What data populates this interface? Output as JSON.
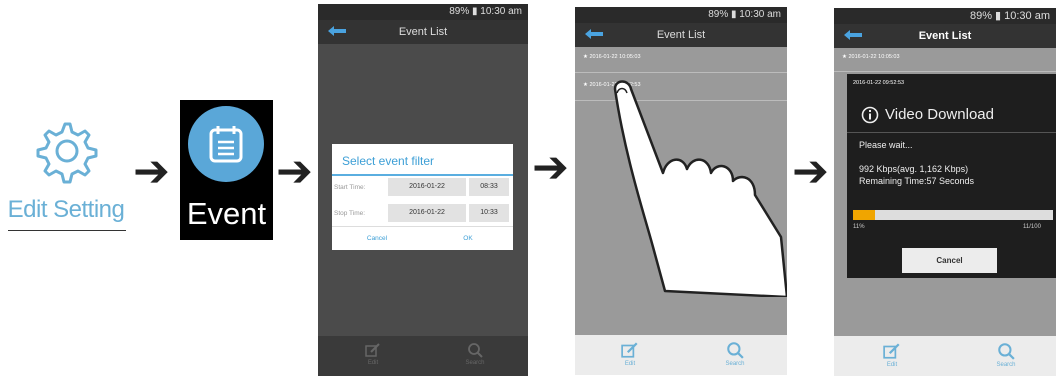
{
  "step1": {
    "label": "Edit Setting",
    "icon": "gear-icon"
  },
  "step2": {
    "label": "Event",
    "icon": "calendar-icon"
  },
  "screen3": {
    "status": "89% ▮ 10:30 am",
    "title": "Event List",
    "dialog": {
      "title": "Select event filter",
      "start_label": "Start Time:",
      "start_date": "2016-01-22",
      "start_time": "08:33",
      "stop_label": "Stop Time:",
      "stop_date": "2016-01-22",
      "stop_time": "10:33",
      "cancel": "Cancel",
      "ok": "OK"
    },
    "bottom": {
      "edit": "Edit",
      "search": "Search"
    }
  },
  "screen4": {
    "status": "89% ▮ 10:30 am",
    "title": "Event List",
    "events": [
      "2016-01-22 10:05:03",
      "2016-01-22 09:52:53"
    ],
    "bottom": {
      "edit": "Edit",
      "search": "Search"
    }
  },
  "screen5": {
    "status": "89% ▮ 10:30 am",
    "title": "Event List",
    "events": [
      "2016-01-22 10:05:03",
      "2016-01-22 09:52:53"
    ],
    "download": {
      "title": "Video Download",
      "wait": "Please wait...",
      "speed": "992 Kbps(avg. 1,162 Kbps)",
      "remaining": "Remaining Time:57 Seconds",
      "percent_label": "11%",
      "count_label": "11/100",
      "progress": 0.11,
      "cancel": "Cancel"
    },
    "bottom": {
      "edit": "Edit",
      "search": "Search"
    }
  },
  "colors": {
    "accent": "#5aa7d8",
    "progress": "#f0a500"
  }
}
